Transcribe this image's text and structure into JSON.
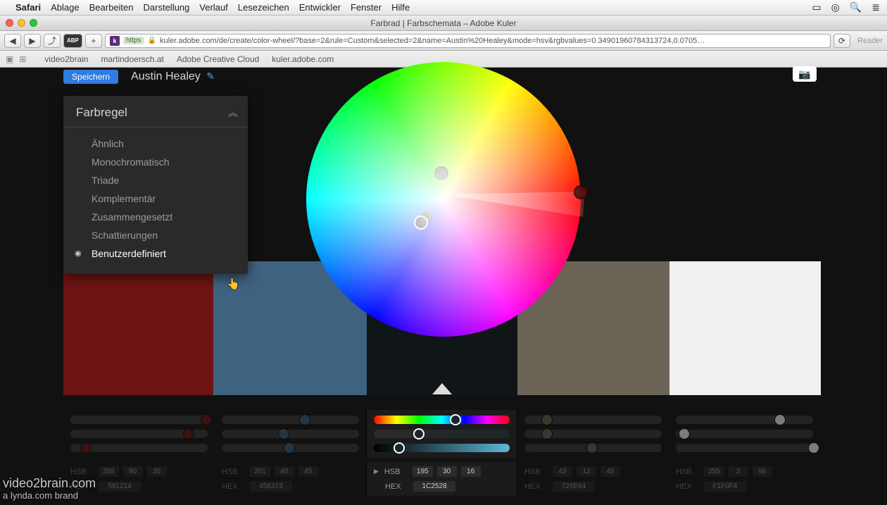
{
  "menubar": {
    "app": "Safari",
    "items": [
      "Ablage",
      "Bearbeiten",
      "Darstellung",
      "Verlauf",
      "Lesezeichen",
      "Entwickler",
      "Fenster",
      "Hilfe"
    ]
  },
  "window": {
    "title": "Farbrad | Farbschemata – Adobe Kuler"
  },
  "toolbar": {
    "https": "https",
    "url": "kuler.adobe.com/de/create/color-wheel/?base=2&rule=Custom&selected=2&name=Austin%20Healey&mode=hsv&rgbvalues=0.34901960784313724,0.0705…",
    "reader": "Reader"
  },
  "bookmarks": [
    "video2brain",
    "martindoersch.at",
    "Adobe Creative Cloud",
    "kuler.adobe.com"
  ],
  "page": {
    "save_label": "Speichern",
    "theme_name": "Austin Healey"
  },
  "panel": {
    "title": "Farbregel",
    "items": [
      "Ähnlich",
      "Monochromatisch",
      "Triade",
      "Komplementär",
      "Zusammengesetzt",
      "Schattierungen",
      "Benutzerdefiniert"
    ],
    "selected_index": 6
  },
  "swatches": [
    {
      "hex": "591214",
      "hsb": {
        "h": "358",
        "s": "80",
        "b": "35"
      }
    },
    {
      "hex": "456373",
      "hsb": {
        "h": "201",
        "s": "40",
        "b": "45"
      }
    },
    {
      "hex": "1C2528",
      "hsb": {
        "h": "195",
        "s": "30",
        "b": "16"
      }
    },
    {
      "hex": "726E64",
      "hsb": {
        "h": "43",
        "s": "12",
        "b": "45"
      }
    },
    {
      "hex": "F1F0F4",
      "hsb": {
        "h": "255",
        "s": "2",
        "b": "96"
      }
    }
  ],
  "labels": {
    "hsb": "HSB",
    "hex": "HEX"
  },
  "watermark": {
    "line1": "video2brain.com",
    "line2": "a lynda.com brand"
  }
}
